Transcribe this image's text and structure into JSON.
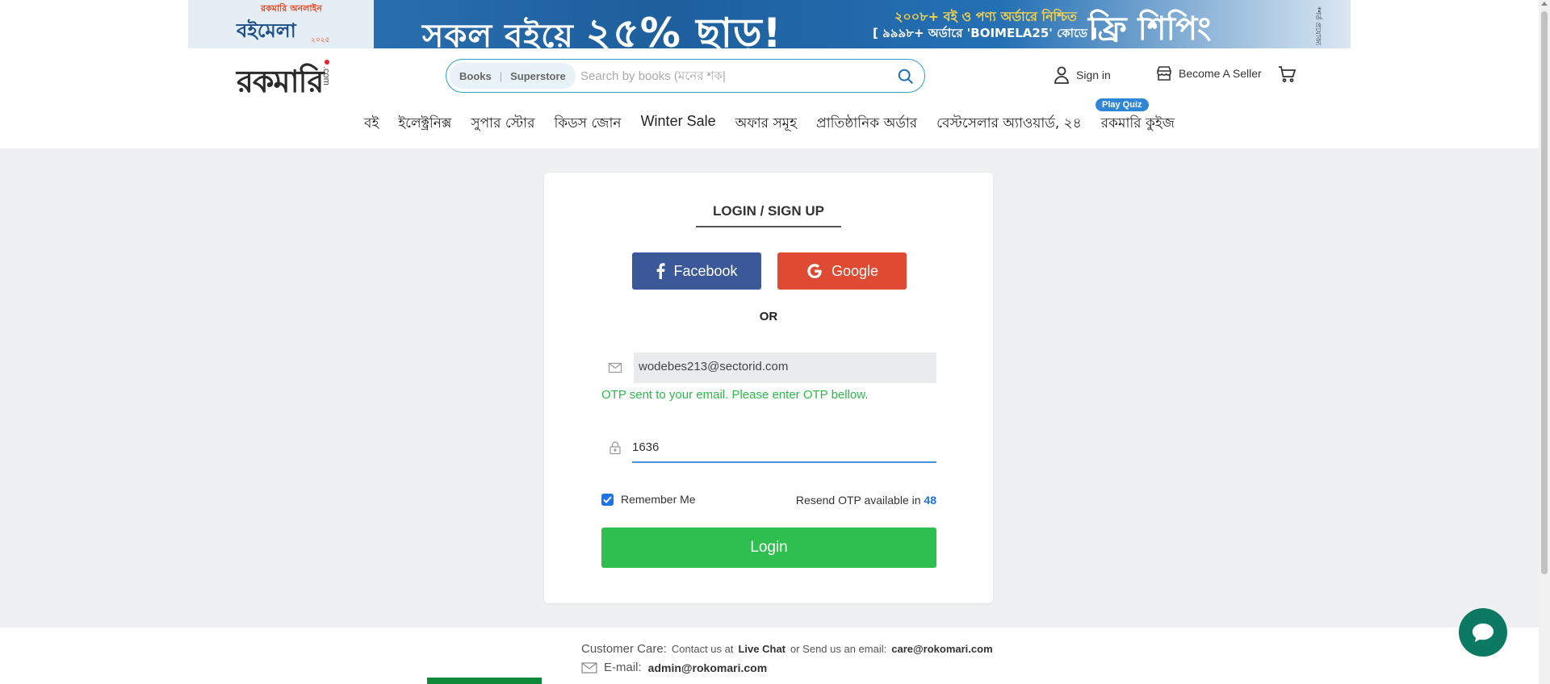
{
  "banner": {
    "logo_top": "রকমারি অনলাইন",
    "logo_main": "বইমেলা",
    "logo_sub": "২০২৫",
    "headline": "সকল বইয়ে",
    "discount": "২৫% ছাড়!",
    "mid_line1": "২০০৮+ বই ও পণ্য অর্ডারে নিশ্চিত",
    "mid_line2": "[ ৯৯৯৮+ অর্ডারে 'BOIMELA25' কোডে ]",
    "right_text": "ফ্রি শিপিং",
    "note": "*শর্ত প্রযোজ্য"
  },
  "header": {
    "logo_text": "রকমারি",
    "logo_suffix": ".com",
    "search": {
      "tab_books": "Books",
      "tab_superstore": "Superstore",
      "placeholder": "Search by books (মনের শক|"
    },
    "sign_in": "Sign in",
    "become_seller": "Become A Seller"
  },
  "nav": {
    "items": [
      "বই",
      "ইলেক্ট্রনিক্স",
      "সুপার স্টোর",
      "কিডস জোন",
      "Winter Sale",
      "অফার সমূহ",
      "প্রাতিষ্ঠানিক অর্ডার",
      "বেস্টসেলার অ্যাওয়ার্ড, ২৪",
      "রকমারি কুইজ"
    ],
    "quiz_badge": "Play Quiz"
  },
  "login": {
    "title": "LOGIN / SIGN UP",
    "facebook": "Facebook",
    "google": "Google",
    "or": "OR",
    "email_value": "wodebes213@sectorid.com",
    "otp_message": "OTP sent to your email. Please enter OTP bellow.",
    "otp_value": "1636",
    "remember_me": "Remember Me",
    "remember_checked": true,
    "resend_prefix": "Resend OTP available in",
    "resend_count": "48",
    "login_button": "Login"
  },
  "footer": {
    "customer_care": "Customer  Care:",
    "contact_prefix": "Contact us at",
    "live_chat": "Live Chat",
    "email_prefix": "or Send us an email:",
    "care_email": "care@rokomari.com",
    "email_label": "E-mail:",
    "admin_email": "admin@rokomari.com"
  },
  "colors": {
    "facebook": "#3b5998",
    "google": "#df4a32",
    "login": "#2fbf4f",
    "otp_message": "#2db84a",
    "accent_blue": "#1a73e8",
    "chat": "#0c7a63"
  }
}
